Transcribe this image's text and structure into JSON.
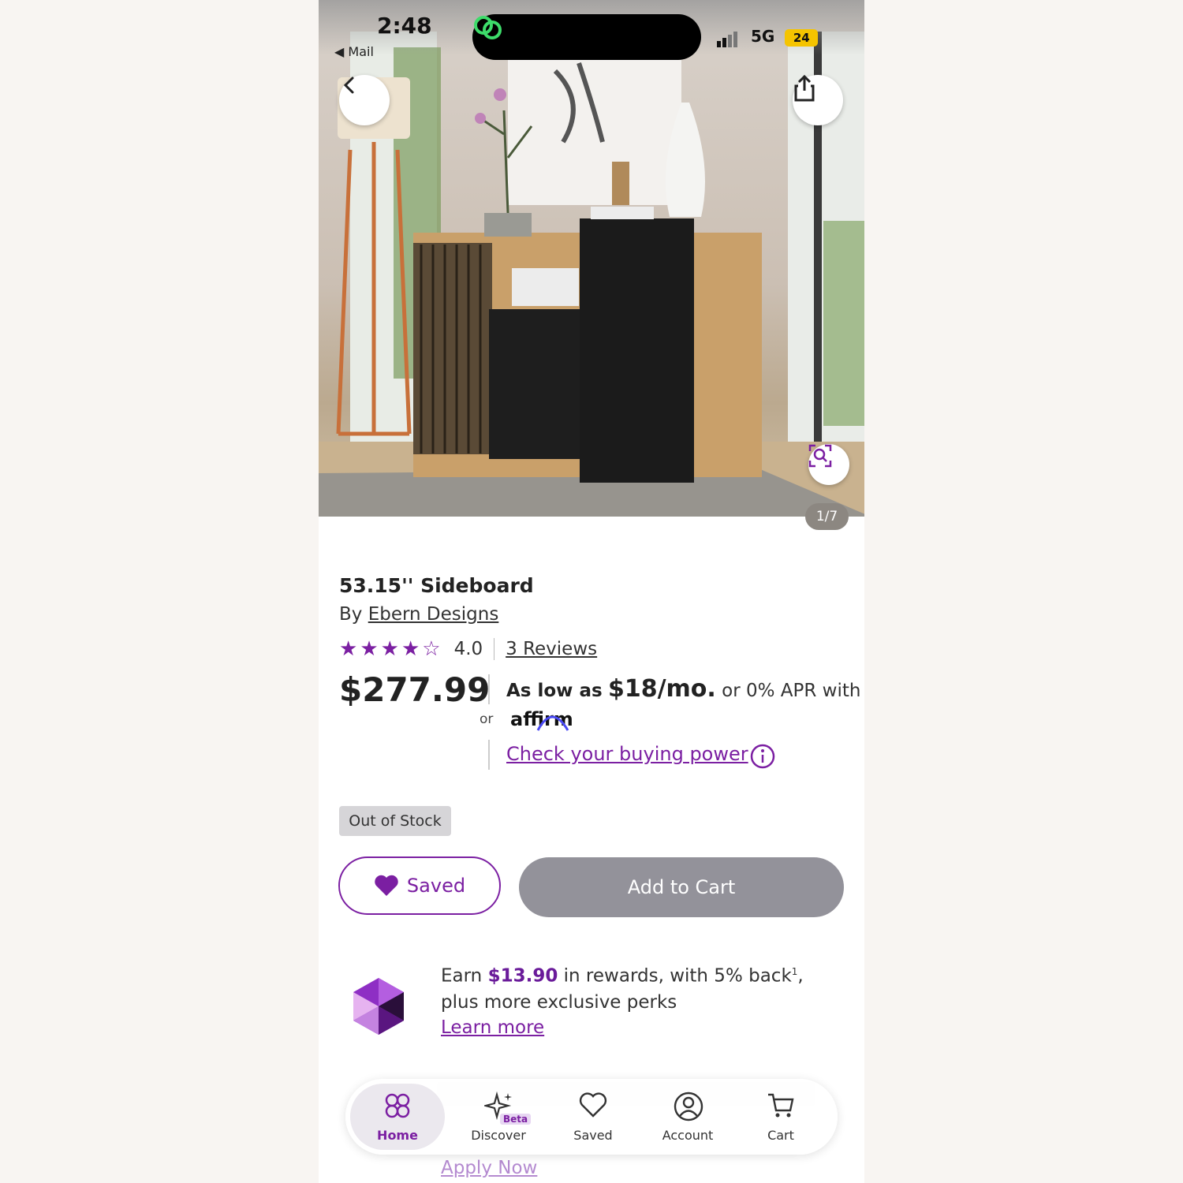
{
  "status_bar": {
    "time": "2:48",
    "back_app": "◀ Mail",
    "network": "5G",
    "battery": "24"
  },
  "gallery": {
    "counter": "1/7"
  },
  "product": {
    "title": "53.15'' Sideboard",
    "by_prefix": "By",
    "brand": "Ebern Designs",
    "rating": "4.0",
    "rating_value": 4,
    "rating_max": 5,
    "reviews": "3 Reviews",
    "price": "$277.99",
    "stock_status": "Out of Stock"
  },
  "financing": {
    "or": "or",
    "as_low_as": "As low as",
    "monthly": "$18/mo.",
    "apr_text": "or 0% APR with",
    "provider": "affirm",
    "check_link": "Check your buying power"
  },
  "actions": {
    "saved_label": "Saved",
    "add_to_cart_label": "Add to Cart"
  },
  "rewards": {
    "earn": "Earn",
    "amount": "$13.90",
    "rest_line": "in rewards, with 5% back",
    "superscript": "1",
    "rest_line2": ", plus more exclusive perks",
    "learn_more": "Learn more",
    "apply_now": "Apply Now"
  },
  "tabbar": {
    "items": [
      {
        "label": "Home",
        "icon": "home-icon",
        "active": true
      },
      {
        "label": "Discover",
        "icon": "sparkle-icon",
        "badge": "Beta"
      },
      {
        "label": "Saved",
        "icon": "heart-icon"
      },
      {
        "label": "Account",
        "icon": "account-icon"
      },
      {
        "label": "Cart",
        "icon": "cart-icon"
      }
    ]
  },
  "colors": {
    "brand_purple": "#7b1fa2",
    "disabled_gray": "#93929a"
  }
}
